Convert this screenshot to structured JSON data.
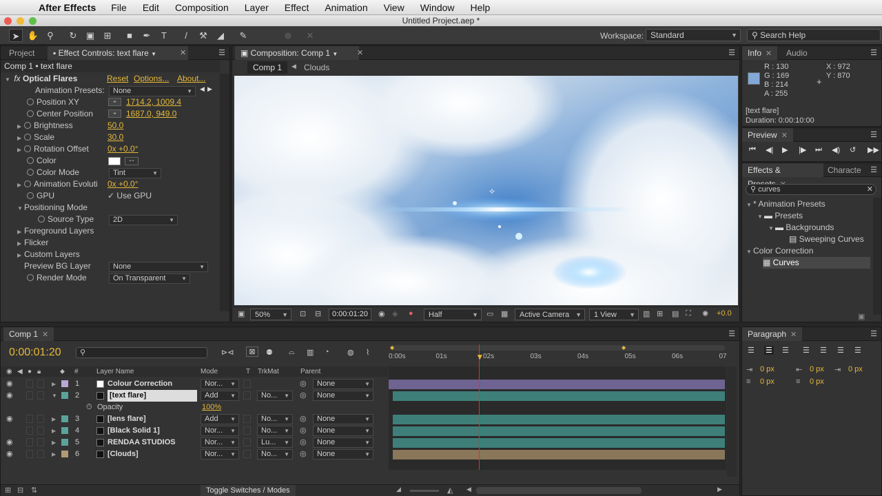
{
  "menubar": {
    "app": "After Effects",
    "items": [
      "File",
      "Edit",
      "Composition",
      "Layer",
      "Effect",
      "Animation",
      "View",
      "Window",
      "Help"
    ]
  },
  "window": {
    "title": "Untitled Project.aep *"
  },
  "toolbar": {
    "workspace_label": "Workspace:",
    "workspace_value": "Standard",
    "search_placeholder": "Search Help"
  },
  "effect_panel": {
    "tab_project": "Project",
    "tab_effect": "Effect Controls: text flare",
    "header": "Comp 1 • text flare",
    "effect_name": "Optical Flares",
    "reset": "Reset",
    "options": "Options...",
    "about": "About...",
    "rows": {
      "anim_presets_label": "Animation Presets:",
      "anim_presets_value": "None",
      "position_xy_label": "Position XY",
      "position_xy_value": "1714.2, 1009.4",
      "center_position_label": "Center Position",
      "center_position_value": "1687.0, 949.0",
      "brightness_label": "Brightness",
      "brightness_value": "50.0",
      "scale_label": "Scale",
      "scale_value": "30.0",
      "rotation_label": "Rotation Offset",
      "rotation_value": "0x +0.0°",
      "color_label": "Color",
      "color_mode_label": "Color Mode",
      "color_mode_value": "Tint",
      "anim_evol_label": "Animation Evoluti",
      "anim_evol_value": "0x +0.0°",
      "gpu_label": "GPU",
      "gpu_value": "Use GPU",
      "positioning_mode": "Positioning Mode",
      "source_type_label": "Source Type",
      "source_type_value": "2D",
      "foreground_layers": "Foreground Layers",
      "flicker": "Flicker",
      "custom_layers": "Custom Layers",
      "preview_bg_label": "Preview BG Layer",
      "preview_bg_value": "None",
      "render_mode_label": "Render Mode",
      "render_mode_value": "On Transparent"
    }
  },
  "comp_panel": {
    "tab": "Composition: Comp 1",
    "breadcrumb_1": "Comp 1",
    "breadcrumb_2": "Clouds",
    "zoom": "50%",
    "timecode": "0:00:01:20",
    "resolution": "Half",
    "camera": "Active Camera",
    "view": "1 View",
    "exposure": "+0.0"
  },
  "info_panel": {
    "tab_info": "Info",
    "tab_audio": "Audio",
    "r": "R : 130",
    "g": "G : 169",
    "b": "B : 214",
    "a": "A : 255",
    "x": "X : 972",
    "y": "Y : 870",
    "layer": "[text flare]",
    "duration": "Duration: 0:00:10:00",
    "swatch": "#82a9d6"
  },
  "preview_panel": {
    "tab": "Preview"
  },
  "effects_presets": {
    "tab": "Effects & Presets",
    "tab2": "Characte",
    "search_value": "curves",
    "tree": {
      "animation_presets": "* Animation Presets",
      "presets": "Presets",
      "backgrounds": "Backgrounds",
      "sweeping_curves": "Sweeping Curves",
      "color_correction": "Color Correction",
      "curves": "Curves"
    }
  },
  "timeline": {
    "tab": "Comp 1",
    "timecode": "0:00:01:20",
    "headers": {
      "num": "#",
      "layer_name": "Layer Name",
      "mode": "Mode",
      "t": "T",
      "trkmat": "TrkMat",
      "parent": "Parent"
    },
    "ruler": [
      "0:00s",
      "01s",
      "02s",
      "03s",
      "04s",
      "05s",
      "06s",
      "07"
    ],
    "layers": [
      {
        "num": "1",
        "name": "Colour Correction",
        "mode": "Nor...",
        "trkmat": "",
        "parent": "None",
        "label": "#b8a6d4"
      },
      {
        "num": "2",
        "name": "[text flare]",
        "mode": "Add",
        "trkmat": "No...",
        "parent": "None",
        "label": "#5aa39a"
      },
      {
        "num": "3",
        "name": "[lens flare]",
        "mode": "Add",
        "trkmat": "No...",
        "parent": "None",
        "label": "#5aa39a"
      },
      {
        "num": "4",
        "name": "[Black Solid 1]",
        "mode": "Nor...",
        "trkmat": "No...",
        "parent": "None",
        "label": "#5aa39a"
      },
      {
        "num": "5",
        "name": "RENDAA STUDIOS",
        "mode": "Nor...",
        "trkmat": "Lu...",
        "parent": "None",
        "label": "#5aa39a"
      },
      {
        "num": "6",
        "name": "[Clouds]",
        "mode": "Nor...",
        "trkmat": "No...",
        "parent": "None",
        "label": "#b39a72"
      }
    ],
    "opacity_label": "Opacity",
    "opacity_value": "100%",
    "toggle_label": "Toggle Switches / Modes",
    "playhead_seconds": 1.83
  },
  "paragraph_panel": {
    "tab": "Paragraph",
    "px1": "0 px",
    "px2": "0 px",
    "px3": "0 px",
    "px4": "0 px",
    "px5": "0 px"
  }
}
